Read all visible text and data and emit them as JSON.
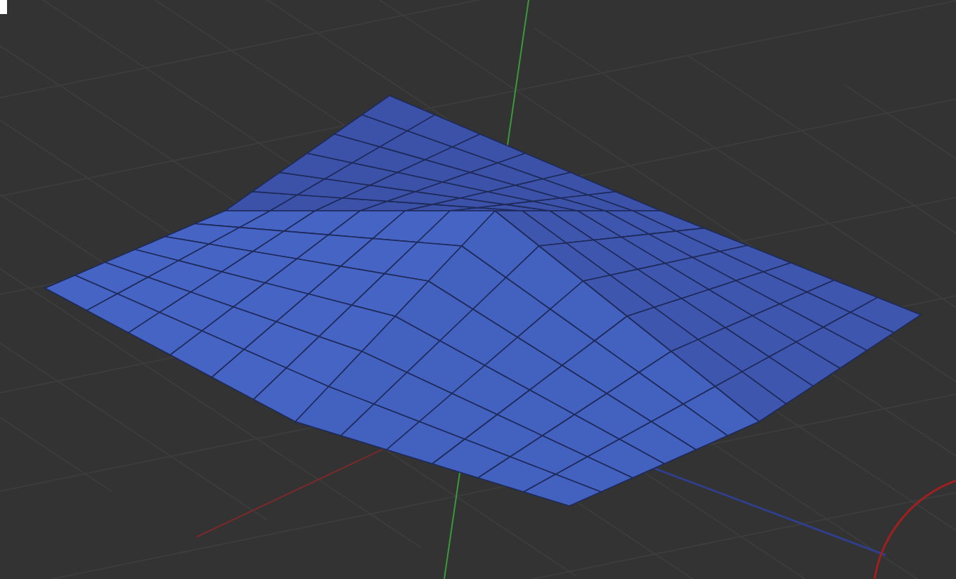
{
  "viewport": {
    "kind": "perspective",
    "grid": true,
    "axes": true
  }
}
